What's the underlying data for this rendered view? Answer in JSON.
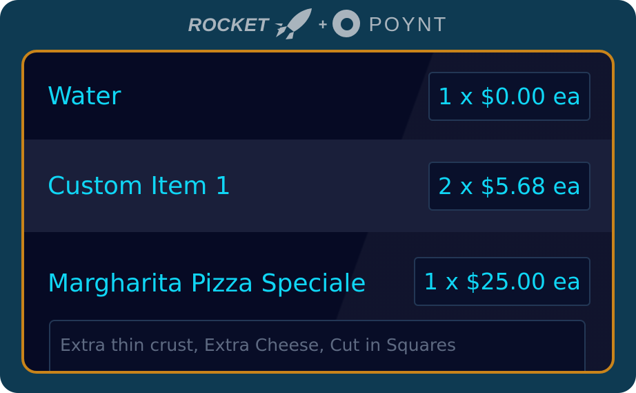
{
  "branding": {
    "left_logo": "ROCKET",
    "separator": "+",
    "right_logo": "POYNT",
    "logo_color": "#a9b4bd"
  },
  "colors": {
    "background": "#0e3a52",
    "panel": "#060a24",
    "panel_border": "#c9841a",
    "accent_text": "#10d6f5",
    "alt_row": "#1a1f3a"
  },
  "order": {
    "items": [
      {
        "name": "Water",
        "quantity_price": "1 x $0.00 ea"
      },
      {
        "name": "Custom Item 1",
        "quantity_price": "2 x $5.68 ea"
      },
      {
        "name": "Margharita Pizza Speciale",
        "quantity_price": "1 x $25.00 ea",
        "note": "Extra thin crust, Extra Cheese, Cut in Squares"
      }
    ]
  }
}
